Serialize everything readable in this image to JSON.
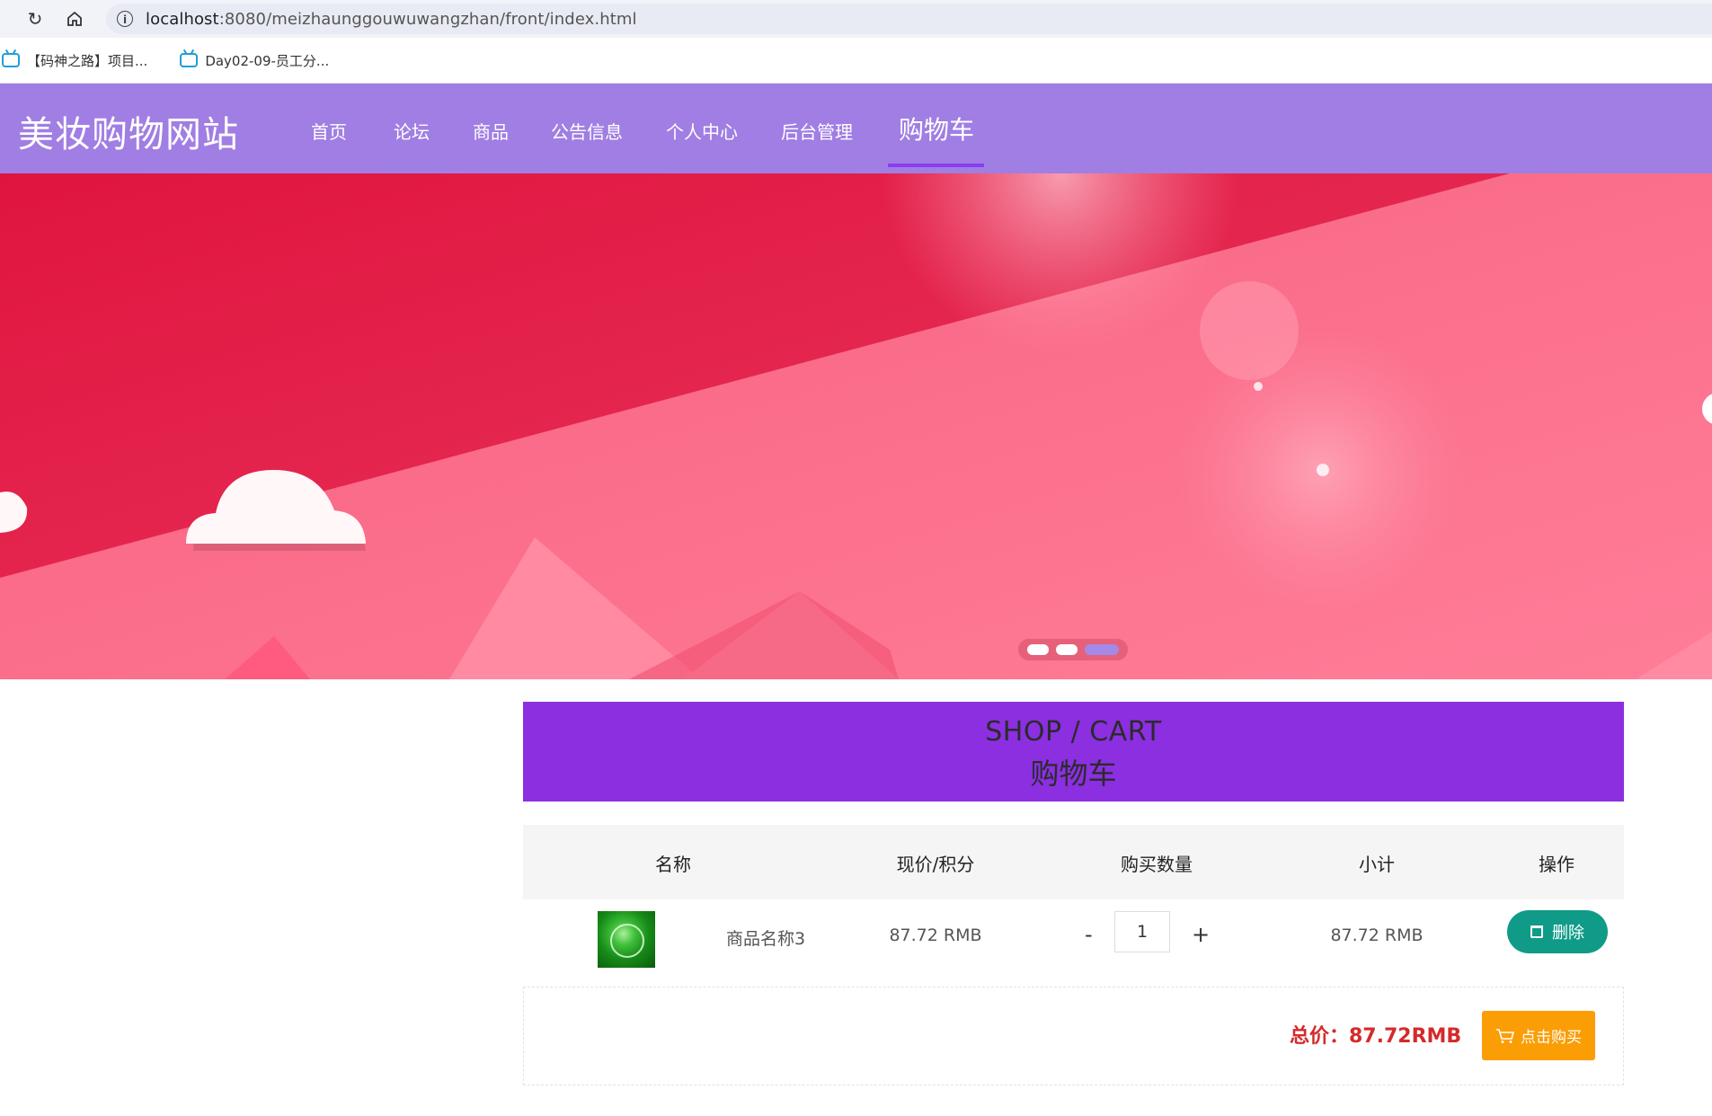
{
  "browser": {
    "url_host": "localhost",
    "url_rest": ":8080/meizhaunggouwuwangzhan/front/index.html",
    "bookmarks": [
      {
        "label": "【码神之路】项目..."
      },
      {
        "label": "Day02-09-员工分..."
      }
    ]
  },
  "site": {
    "logo": "美妆购物网站",
    "nav": [
      {
        "label": "首页"
      },
      {
        "label": "论坛"
      },
      {
        "label": "商品"
      },
      {
        "label": "公告信息"
      },
      {
        "label": "个人中心"
      },
      {
        "label": "后台管理"
      },
      {
        "label": "购物车"
      }
    ],
    "active_nav": "购物车"
  },
  "cart": {
    "title_en": "SHOP / CART",
    "title_cn": "购物车",
    "columns": [
      "名称",
      "现价/积分",
      "购买数量",
      "小计",
      "操作"
    ],
    "items": [
      {
        "name": "商品名称3",
        "price": "87.72 RMB",
        "quantity": "1",
        "subtotal": "87.72 RMB",
        "minus": "-",
        "plus": "+",
        "delete_label": "删除"
      }
    ],
    "total_text": "总价：87.72RMB",
    "buy_label": "点击购买"
  },
  "colors": {
    "header_bg": "#a07ee3",
    "cart_title_bg": "#8b2fe1",
    "delete_btn": "#0f9b88",
    "buy_btn": "#fb9d05",
    "total_text": "#d42a2a"
  }
}
